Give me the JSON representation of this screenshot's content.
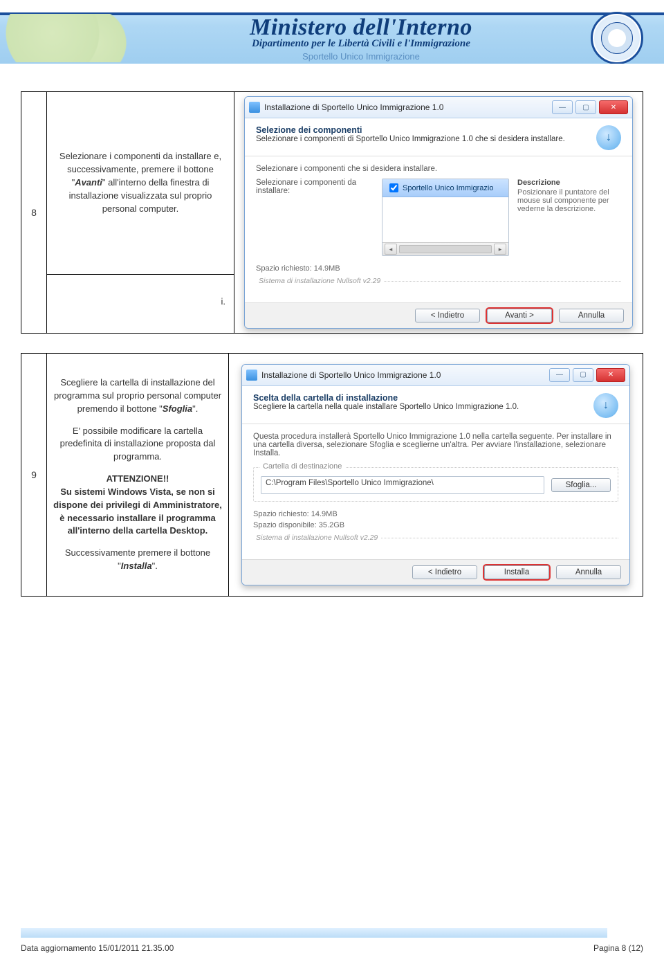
{
  "header": {
    "title_main": "Ministero dell'Interno",
    "title_sub": "Dipartimento per le Libertà Civili e l'Immigrazione",
    "title_sub2": "Sportello Unico Immigrazione"
  },
  "step8": {
    "num": "8",
    "instr_lines": [
      "Selezionare i componenti da installare e, successivamente, premere il bottone \"",
      "Avanti",
      "\" all'interno della finestra di installazione visualizzata sul proprio personal computer."
    ],
    "tag_i": "i.",
    "win": {
      "title": "Installazione di Sportello Unico Immigrazione 1.0",
      "heading": "Selezione dei componenti",
      "subheading": "Selezionare i componenti di Sportello Unico Immigrazione 1.0 che si desidera installare.",
      "body_line": "Selezionare i componenti che si desidera installare.",
      "left_label": "Selezionare i componenti da installare:",
      "list_item": "Sportello Unico Immigrazio",
      "desc_title": "Descrizione",
      "desc_text": "Posizionare il puntatore del mouse sul componente per vederne la descrizione.",
      "space_req": "Spazio richiesto: 14.9MB",
      "sys_line": "Sistema di installazione Nullsoft v2.29",
      "btn_back": "< Indietro",
      "btn_next": "Avanti >",
      "btn_cancel": "Annulla"
    }
  },
  "step9": {
    "num": "9",
    "instr_p1_a": "Scegliere la cartella di installazione del programma sul proprio personal computer premendo il bottone \"",
    "instr_p1_b": "Sfoglia",
    "instr_p1_c": "\".",
    "instr_p2": "E' possibile modificare la cartella predefinita di installazione proposta dal programma.",
    "instr_p3_title": "ATTENZIONE!!",
    "instr_p3_body": "Su sistemi Windows Vista, se non si dispone dei privilegi di Amministratore, è necessario installare il programma all'interno della cartella Desktop.",
    "instr_p4_a": "Successivamente premere il bottone \"",
    "instr_p4_b": "Installa",
    "instr_p4_c": "\".",
    "win": {
      "title": "Installazione di Sportello Unico Immigrazione 1.0",
      "heading": "Scelta della cartella di installazione",
      "subheading": "Scegliere la cartella nella quale installare Sportello Unico Immigrazione 1.0.",
      "body_p": "Questa procedura installerà Sportello Unico Immigrazione 1.0 nella cartella seguente. Per installare in una cartella diversa, selezionare Sfoglia e sceglierne un'altra. Per avviare l'installazione, selezionare Installa.",
      "group_title": "Cartella di destinazione",
      "path": "C:\\Program Files\\Sportello Unico Immigrazione\\",
      "btn_browse": "Sfoglia...",
      "space_req": "Spazio richiesto: 14.9MB",
      "space_avail": "Spazio disponibile: 35.2GB",
      "sys_line": "Sistema di installazione Nullsoft v2.29",
      "btn_back": "< Indietro",
      "btn_install": "Installa",
      "btn_cancel": "Annulla"
    }
  },
  "footer": {
    "left": "Data aggiornamento 15/01/2011 21.35.00",
    "right": "Pagina 8 (12)"
  }
}
